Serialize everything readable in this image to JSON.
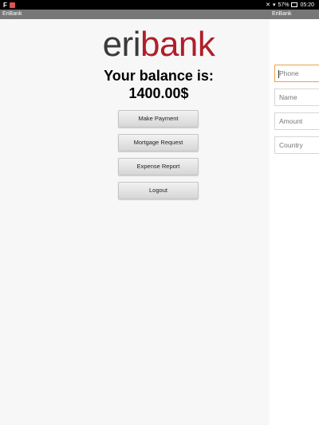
{
  "status_bar": {
    "left_glyph": "F",
    "notification_icon": "notification-icon",
    "mute_icon": "mute-icon",
    "wifi_icon": "wifi-icon",
    "battery_percent": "57%",
    "time": "05:20"
  },
  "left_title": "EriBank",
  "right_title": "EriBank",
  "logo": {
    "eri": "eri",
    "bank": "bank"
  },
  "balance_title": "Your balance is:",
  "balance_value": "1400.00$",
  "buttons": [
    {
      "label": "Make Payment"
    },
    {
      "label": "Mortgage Request"
    },
    {
      "label": "Expense Report"
    },
    {
      "label": "Logout"
    }
  ],
  "form": {
    "phone_placeholder": "Phone",
    "name_placeholder": "Name",
    "amount_placeholder": "Amount",
    "country_placeholder": "Country"
  },
  "colors": {
    "brand_red": "#b01e2a",
    "focus_orange": "#f0a24a"
  }
}
